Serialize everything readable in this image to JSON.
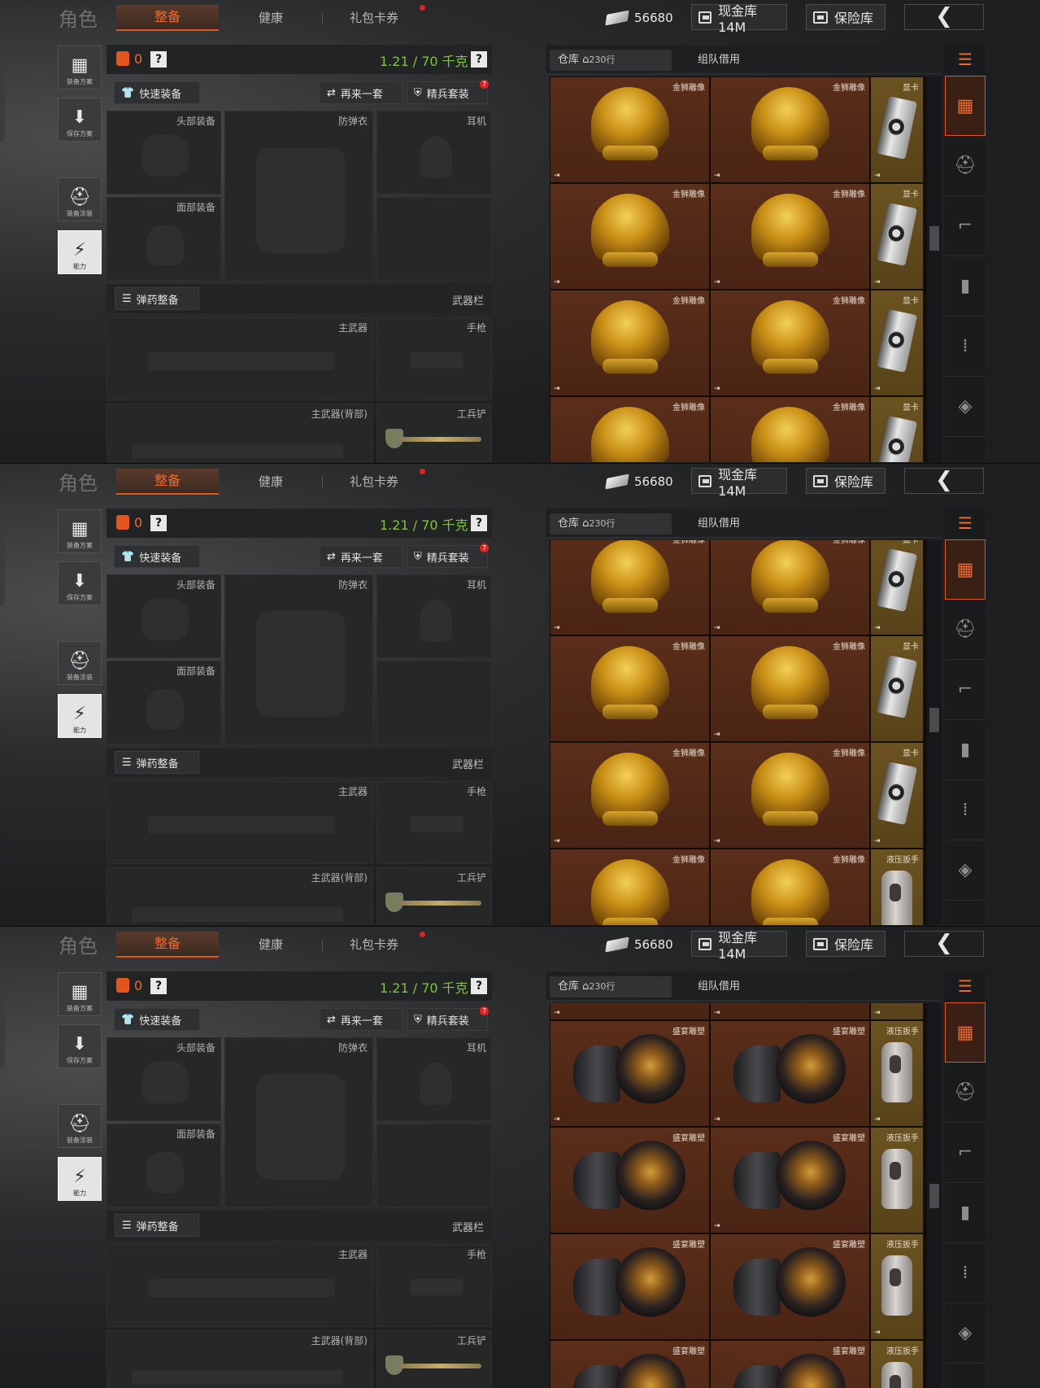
{
  "header": {
    "role_label": "角色",
    "tabs": [
      "整备",
      "健康",
      "礼包卡券"
    ],
    "cash": "56680",
    "vault_button": "现金库 14M",
    "safe_button": "保险库",
    "back_glyph": "❮"
  },
  "left_column": {
    "loadout_scheme": "装备方案",
    "save_scheme": "保存方案",
    "equip_skin": "装备涂装",
    "ability": "能力"
  },
  "loadout": {
    "armor_count": "0",
    "help_glyph": "?",
    "weight": "1.21 / 70 千克",
    "quick_equip": "快速装备",
    "again": "再来一套",
    "elite_set": "精兵套装",
    "elite_badge": "7",
    "slots": {
      "head": "头部装备",
      "armor": "防弹衣",
      "headset": "耳机",
      "face": "面部装备"
    },
    "ammo_button": "弹药整备",
    "weapon_bar": "武器栏",
    "weapons": {
      "primary": "主武器",
      "pistol": "手枪",
      "primary_back": "主武器(背部)",
      "shovel": "工兵铲"
    }
  },
  "warehouse": {
    "tab_storage": "仓库",
    "rows": "230行",
    "tab_team_loan": "组队借用",
    "item_lion": "金狮雕像",
    "item_gpu": "显卡",
    "item_bust": "盛宴雕塑",
    "item_wrench": "液压扳手",
    "exit_glyph": "⇥"
  },
  "colors": {
    "accent": "#e0561e",
    "weight_green": "#7ec43c",
    "slot_brown": "#5a2e1a",
    "slot_olive": "#6b5220"
  },
  "icons": [
    "cash-icon",
    "vault-icon",
    "safe-icon",
    "back-arrow-icon",
    "vest-icon",
    "help-icon",
    "shirt-icon",
    "swap-icon",
    "shield-icon",
    "ammo-icon",
    "house-icon",
    "lion-statue-icon",
    "gpu-icon",
    "bust-icon",
    "wrench-icon",
    "armor-tab-icon",
    "helmet-tab-icon",
    "rifle-tab-icon",
    "magazine-tab-icon",
    "bullet-tab-icon",
    "vest-tab-icon"
  ]
}
